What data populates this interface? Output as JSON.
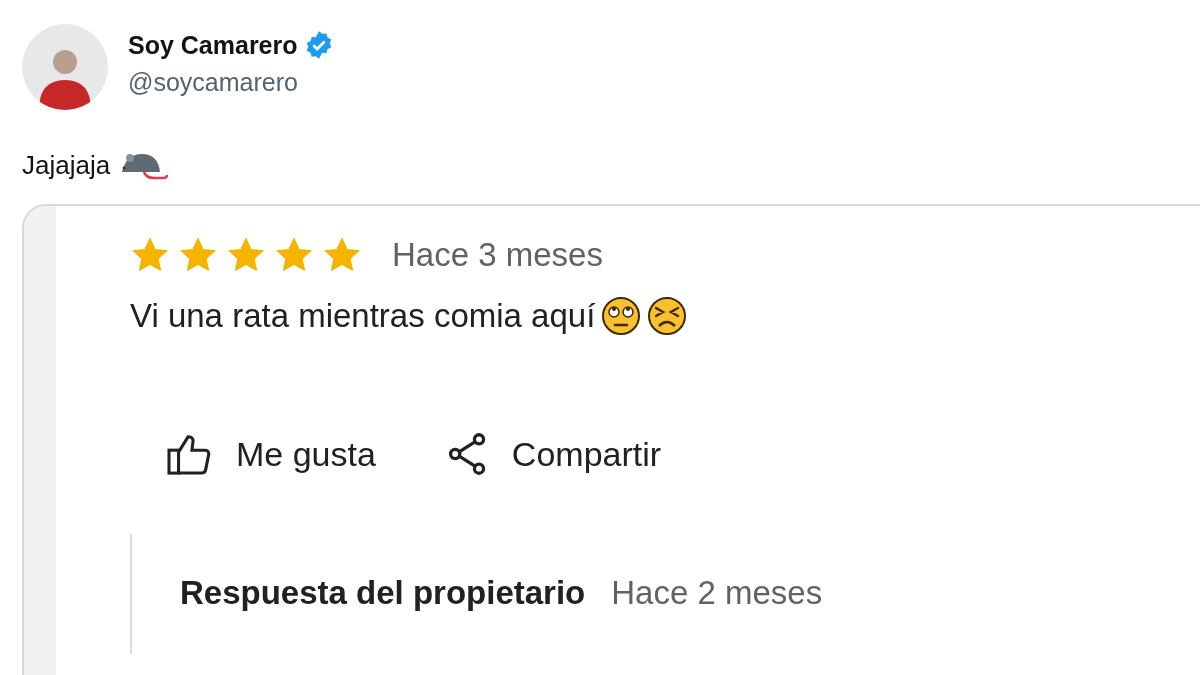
{
  "author": {
    "name": "Soy Camarero",
    "handle": "@soycamarero",
    "verified": true
  },
  "post_text": "Jajajaja",
  "review": {
    "stars": 5,
    "time": "Hace 3 meses",
    "text": "Vi una rata mientras comia aquí",
    "actions": [
      {
        "kind": "like",
        "label": "Me gusta"
      },
      {
        "kind": "share",
        "label": "Compartir"
      }
    ],
    "owner_reply": {
      "title": "Respuesta del propietario",
      "time": "Hace 2 meses"
    }
  }
}
